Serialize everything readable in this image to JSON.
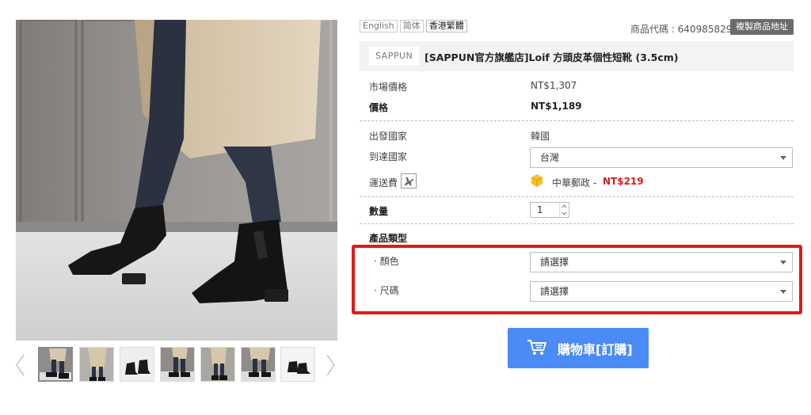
{
  "languages": [
    {
      "label": "English",
      "active": false
    },
    {
      "label": "简体",
      "active": false
    },
    {
      "label": "香港繁體",
      "active": true
    }
  ],
  "product_code_text": "商品代碼 : 640985829",
  "copy_address_label": "複製商品地址",
  "brand": "SAPPUN",
  "title": "[SAPPUN官方旗艦店]Loif 方頭皮革個性短靴 (3.5cm)",
  "pricing": {
    "market_label": "市場價格",
    "market_value": "NT$1,307",
    "price_label": "價格",
    "price_value": "NT$1,189"
  },
  "shipping": {
    "origin_label": "出發國家",
    "origin_value": "韓國",
    "destination_label": "到達國家",
    "destination_value": "台灣",
    "fee_label": "運送費",
    "carrier": "中華郵政 -",
    "fee_value": "NT$219"
  },
  "quantity": {
    "label": "數量",
    "value": "1"
  },
  "options": {
    "section_label": "產品類型",
    "color_label": "· 顏色",
    "color_value": "請選擇",
    "size_label": "· 尺碼",
    "size_value": "請選擇"
  },
  "cart_label": "購物車[訂購]",
  "colors": {
    "accent_blue": "#4b8bf5",
    "highlight_red": "#e01a1a",
    "price_red": "#d71b1b",
    "copy_btn_gray": "#6b6b6b"
  },
  "thumbnail_count": 7,
  "active_thumbnail": 1
}
